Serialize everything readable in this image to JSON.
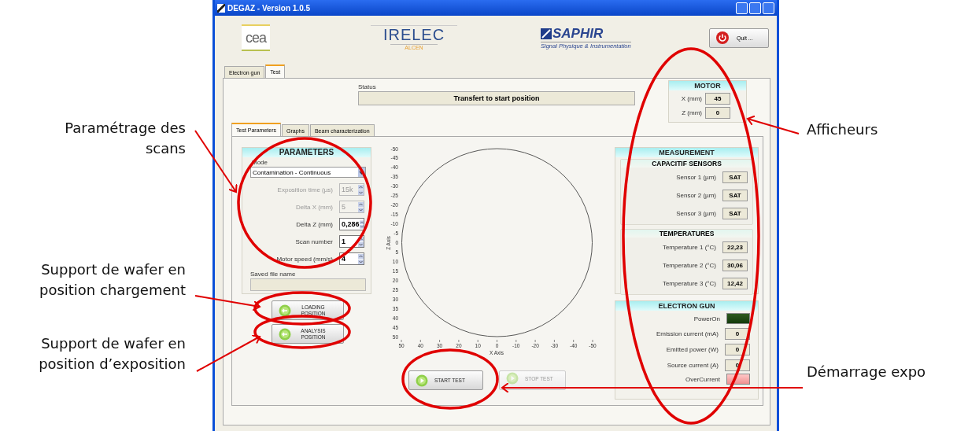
{
  "window": {
    "title": "DEGAZ - Version 1.0.5"
  },
  "header": {
    "logos": [
      {
        "kind": "cea",
        "text": "cea"
      },
      {
        "kind": "irelec",
        "text": "IRELEC",
        "subtitle": "ALCEN"
      },
      {
        "kind": "saphir",
        "text": "SAPHIR",
        "subtitle": "Signal Physique & Instrumentation"
      }
    ],
    "quit_button": "Quit ..."
  },
  "tabs": [
    {
      "label": "Electron gun",
      "selected": false
    },
    {
      "label": "Test",
      "selected": true
    }
  ],
  "status": {
    "label": "Status",
    "value": "Transfert to start position"
  },
  "motor": {
    "title": "MOTOR",
    "fields": [
      {
        "label": "X (mm)",
        "value": "45"
      },
      {
        "label": "Z (mm)",
        "value": "0"
      }
    ]
  },
  "subtabs": [
    {
      "label": "Test Parameters",
      "selected": true
    },
    {
      "label": "Graphs",
      "selected": false
    },
    {
      "label": "Beam characterization",
      "selected": false
    }
  ],
  "parameters": {
    "title": "PARAMETERS",
    "mode_label": "Mode",
    "mode_value": "Contamination - Continuous",
    "fields": [
      {
        "label": "Exposition time (µs)",
        "value": "15k",
        "disabled": true
      },
      {
        "label": "Delta X (mm)",
        "value": "5",
        "disabled": true
      },
      {
        "label": "Delta Z (mm)",
        "value": "0,286",
        "disabled": false
      },
      {
        "label": "Scan number",
        "value": "1",
        "disabled": false
      },
      {
        "label": "Motor speed (mm/s)",
        "value": "4",
        "disabled": false
      }
    ],
    "saved_file_label": "Saved file name"
  },
  "position_buttons": [
    {
      "label": "LOADING POSITION"
    },
    {
      "label": "ANALYSIS POSITION"
    }
  ],
  "plot": {
    "xlabel": "X Axis",
    "ylabel": "Z Axis",
    "yticks": [
      "-50",
      "-45",
      "-40",
      "-35",
      "-30",
      "-25",
      "-20",
      "-15",
      "-10",
      "-5",
      "0",
      "5",
      "10",
      "15",
      "20",
      "25",
      "30",
      "35",
      "40",
      "45",
      "50"
    ],
    "xticks": [
      "50",
      "40",
      "30",
      "20",
      "10",
      "0",
      "-10",
      "-20",
      "-30",
      "-40",
      "-50"
    ]
  },
  "test_buttons": [
    {
      "label": "START TEST",
      "disabled": false
    },
    {
      "label": "STOP TEST",
      "disabled": true
    }
  ],
  "measurement": {
    "title": "MEASUREMENT",
    "groups": [
      {
        "title": "CAPACITIF SENSORS",
        "rows": [
          {
            "label": "Sensor 1 (µm)",
            "value": "SAT"
          },
          {
            "label": "Sensor 2 (µm)",
            "value": "SAT"
          },
          {
            "label": "Sensor 3 (µm)",
            "value": "SAT"
          }
        ]
      },
      {
        "title": "TEMPERATURES",
        "rows": [
          {
            "label": "Temperature 1 (°C)",
            "value": "22,23"
          },
          {
            "label": "Temperature 2 (°C)",
            "value": "30,06"
          },
          {
            "label": "Temperature 3 (°C)",
            "value": "12,42"
          }
        ]
      }
    ]
  },
  "electron_gun": {
    "title": "ELECTRON GUN",
    "rows": [
      {
        "kind": "indicator",
        "label": "PowerOn",
        "on": true
      },
      {
        "kind": "value",
        "label": "Emission current (mA)",
        "value": "0"
      },
      {
        "kind": "value",
        "label": "Emitted power (W)",
        "value": "0"
      },
      {
        "kind": "value",
        "label": "Source current (A)",
        "value": "0"
      },
      {
        "kind": "indicator",
        "label": "OverCurrent",
        "on": false
      }
    ]
  },
  "left_annotations": [
    "Paramétrage des\nscans",
    "Support de wafer en\nposition chargement",
    "Support de wafer en\nposition d’exposition"
  ],
  "right_annotations": [
    "Afficheurs",
    "Démarrage expo"
  ]
}
